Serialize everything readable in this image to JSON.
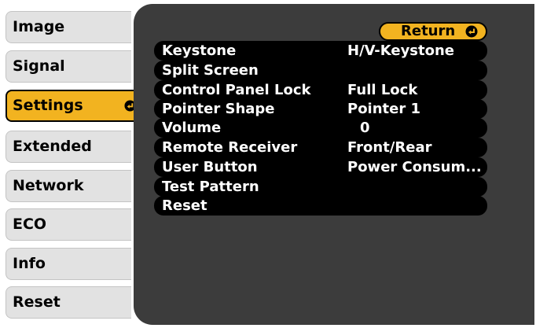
{
  "sidebar": {
    "items": [
      {
        "label": "Image"
      },
      {
        "label": "Signal"
      },
      {
        "label": "Settings"
      },
      {
        "label": "Extended"
      },
      {
        "label": "Network"
      },
      {
        "label": "ECO"
      },
      {
        "label": "Info"
      },
      {
        "label": "Reset"
      }
    ],
    "selected": "Settings"
  },
  "panel": {
    "return_label": "Return",
    "rows": [
      {
        "label": "Keystone",
        "value": "H/V-Keystone"
      },
      {
        "label": "Split Screen",
        "value": ""
      },
      {
        "label": "Control Panel Lock",
        "value": "Full Lock"
      },
      {
        "label": "Pointer Shape",
        "value": "Pointer 1"
      },
      {
        "label": "Volume",
        "value": "0"
      },
      {
        "label": "Remote Receiver",
        "value": "Front/Rear"
      },
      {
        "label": "User Button",
        "value": "Power Consum..."
      },
      {
        "label": "Test Pattern",
        "value": ""
      },
      {
        "label": "Reset",
        "value": ""
      }
    ]
  },
  "colors": {
    "highlight": "#f2b320",
    "panel_bg": "#3c3c3c",
    "row_bg": "#000000",
    "tab_bg": "#e2e2e2"
  }
}
